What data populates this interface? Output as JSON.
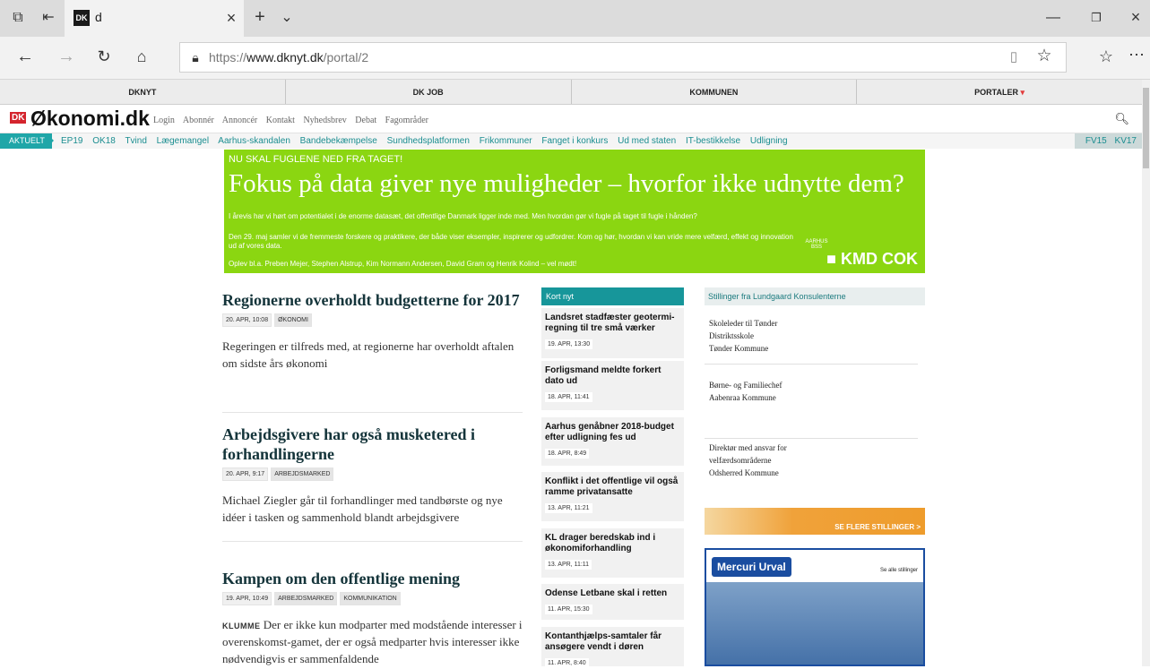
{
  "browser": {
    "tab_title": "d",
    "favicon": "DK",
    "url_prefix": "https://",
    "url_host": "www.dknyt.dk",
    "url_path": "/portal/2",
    "icons": {
      "tab_actions": "tab-set-aside-icon",
      "close": "close-icon",
      "new_tab": "plus-icon",
      "tab_list": "chevron-down-icon",
      "back": "back-arrow-icon",
      "forward": "forward-arrow-icon",
      "refresh": "refresh-icon",
      "home": "home-icon",
      "lock": "lock-icon",
      "reading": "reading-view-icon",
      "favorite": "star-icon",
      "favorites_hub": "favorites-list-icon",
      "more": "more-icon"
    }
  },
  "topnav": [
    "DKNYT",
    "DK JOB",
    "KOMMUNEN",
    "PORTALER"
  ],
  "logo": {
    "badge": "DK",
    "text": "Økonomi.dk"
  },
  "sitelinks": [
    "Login",
    "Abonnér",
    "Annoncér",
    "Kontakt",
    "Nyhedsbrev",
    "Debat",
    "Fagområder"
  ],
  "tagbar": {
    "label": "AKTUELT",
    "tags": [
      "EP19",
      "OK18",
      "Tvind",
      "Lægemangel",
      "Aarhus-skandalen",
      "Bandebekæmpelse",
      "Sundhedsplatformen",
      "Frikommuner",
      "Fanget i konkurs",
      "Ud med staten",
      "IT-bestikkelse",
      "Udligning"
    ],
    "right": [
      "FV15",
      "KV17"
    ]
  },
  "banner": {
    "kicker": "NU SKAL FUGLENE NED FRA TAGET!",
    "headline": "Fokus på data giver nye muligheder – hvorfor ikke udnytte dem?",
    "p1": "I årevis har vi hørt om potentialet i de enorme datasæt, det offentlige Danmark ligger inde med. Men hvordan gør vi fugle på taget til fugle i hånden?",
    "p2": "Den 29. maj samler vi de fremmeste forskere og praktikere, der både viser eksempler, inspirerer og udfordrer. Kom og hør, hvordan vi kan vride mere velfærd, effekt og innovation ud af vores data.",
    "p3": "Oplev bl.a. Preben Mejer, Stephen Alstrup, Kim Normann Andersen, David Gram og Henrik Kolind – vel mødt!",
    "logo_small": "AARHUS BSS",
    "logos": "■ KMD COK"
  },
  "articles": [
    {
      "title": "Regionerne overholdt budgetterne for 2017",
      "date": "20. APR, 10:08",
      "cats": [
        "ØKONOMI"
      ],
      "lead_prefix": "",
      "lead": "Regeringen er tilfreds med, at regionerne har overholdt aftalen om sidste års økonomi"
    },
    {
      "title": "Arbejdsgivere har også musketered i forhandlingerne",
      "date": "20. APR, 9:17",
      "cats": [
        "ARBEJDSMARKED"
      ],
      "lead_prefix": "",
      "lead": "Michael Ziegler går til forhandlinger med tandbørste og nye idéer i tasken og sammenhold blandt arbejdsgivere"
    },
    {
      "title": "Kampen om den offentlige mening",
      "date": "19. APR, 10:49",
      "cats": [
        "ARBEJDSMARKED",
        "KOMMUNIKATION"
      ],
      "lead_prefix": "KLUMME",
      "lead": " Der er ikke kun modparter med modstående interesser i overenskomst-gamet, der er også medparter hvis interesser ikke nødvendigvis er sammenfaldende"
    }
  ],
  "kortnyt": {
    "header": "Kort nyt",
    "items": [
      {
        "title": "Landsret stadfæster geotermi-regning til tre små værker",
        "date": "19. APR, 13:30"
      },
      {
        "title": "Forligsmand meldte forkert dato ud",
        "date": "18. APR, 11:41"
      },
      {
        "title": "Aarhus genåbner 2018-budget efter udligning fes ud",
        "date": "18. APR, 8:49"
      },
      {
        "title": "Konflikt i det offentlige vil også ramme privatansatte",
        "date": "13. APR, 11:21"
      },
      {
        "title": "KL drager beredskab ind i økonomiforhandling",
        "date": "13. APR, 11:11"
      },
      {
        "title": "Odense Letbane skal i retten",
        "date": "11. APR, 15:30"
      },
      {
        "title": "Kontanthjælps-samtaler får ansøgere vendt i døren",
        "date": "11. APR, 8:40"
      }
    ]
  },
  "jobs": {
    "header": "Stillinger fra Lundgaard Konsulenterne",
    "items": [
      {
        "lines": [
          "Skoleleder til Tønder",
          "Distriktsskole",
          "Tønder Kommune"
        ]
      },
      {
        "lines": [
          "Børne- og Familiechef",
          "Aabenraa Kommune"
        ]
      },
      {
        "lines": [
          "Direktør med ansvar for",
          "velfærdsområderne",
          "Odsherred Kommune"
        ]
      }
    ],
    "more": "SE FLERE STILLINGER >",
    "mercuri_logo": "Mercuri Urval",
    "mercuri_link": "Se alle stillinger"
  }
}
